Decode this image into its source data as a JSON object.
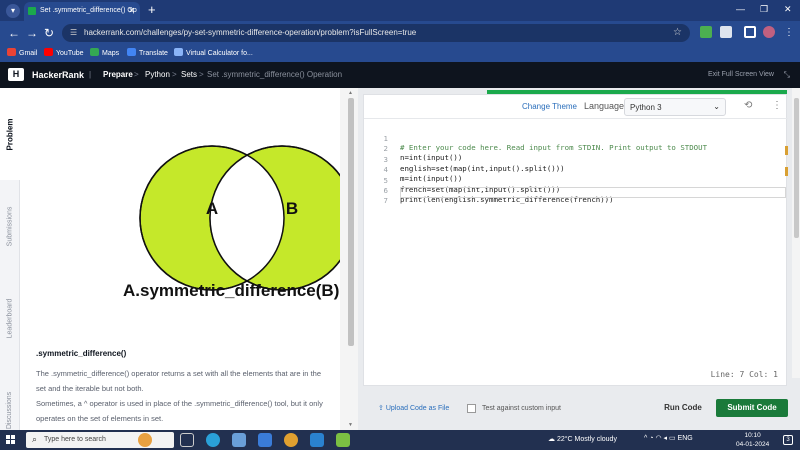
{
  "browser": {
    "tab_title": "Set .symmetric_difference() Op",
    "new_tab": "+",
    "win_min": "—",
    "win_max": "❐",
    "win_close": "✕",
    "url": "hackerrank.com/challenges/py-set-symmetric-difference-operation/problem?isFullScreen=true",
    "bookmarks": [
      "Gmail",
      "YouTube",
      "Maps",
      "Translate",
      "Virtual Calculator fo..."
    ]
  },
  "header": {
    "logo_text": "H",
    "brand": "HackerRank",
    "breadcrumbs": [
      "Prepare",
      "Python",
      "Sets",
      "Set .symmetric_difference() Operation"
    ],
    "crumb_sep": ">",
    "exit_full_screen": "Exit Full Screen View"
  },
  "side_tabs": [
    "Problem",
    "Submissions",
    "Leaderboard",
    "Discussions"
  ],
  "problem": {
    "diagram": {
      "circle_a": "A",
      "circle_b": "B",
      "caption": "A.symmetric_difference(B) or"
    },
    "section_title": ".symmetric_difference()",
    "paragraph_1": "The .symmetric_difference() operator returns a set with all the elements that are in the set and the iterable but not both.",
    "paragraph_2": "Sometimes, a ^ operator is used in place of the .symmetric_difference() tool, but it only operates on the set of elements in set."
  },
  "editor": {
    "change_theme": "Change Theme",
    "language_label": "Language",
    "language_value": "Python 3",
    "code_lines": [
      {
        "n": "1",
        "text": "# Enter your code here. Read input from STDIN. Print output to STDOUT"
      },
      {
        "n": "2",
        "text": "n=int(input())"
      },
      {
        "n": "3",
        "text": "english=set(map(int,input().split()))"
      },
      {
        "n": "4",
        "text": "m=int(input())"
      },
      {
        "n": "5",
        "text": "french=set(map(int,input().split()))"
      },
      {
        "n": "6",
        "text": "print(len(english.symmetric_difference(french)))"
      },
      {
        "n": "7",
        "text": ""
      }
    ],
    "cursor_position": "Line: 7 Col: 1",
    "upload_label": "Upload Code as File",
    "custom_input_label": "Test against custom input",
    "run_label": "Run Code",
    "submit_label": "Submit Code"
  },
  "taskbar": {
    "search_placeholder": "Type here to search",
    "weather": "22°C  Mostly cloudy",
    "lang": "ENG",
    "time": "10:10",
    "date": "04-01-2024",
    "notif_count": "3"
  },
  "colors": {
    "venn_fill": "#c5e82a",
    "hr_dark": "#0e141e",
    "hr_green": "#1ba94c",
    "submit_green": "#1a7a3a",
    "link_blue": "#2a6ebb"
  }
}
